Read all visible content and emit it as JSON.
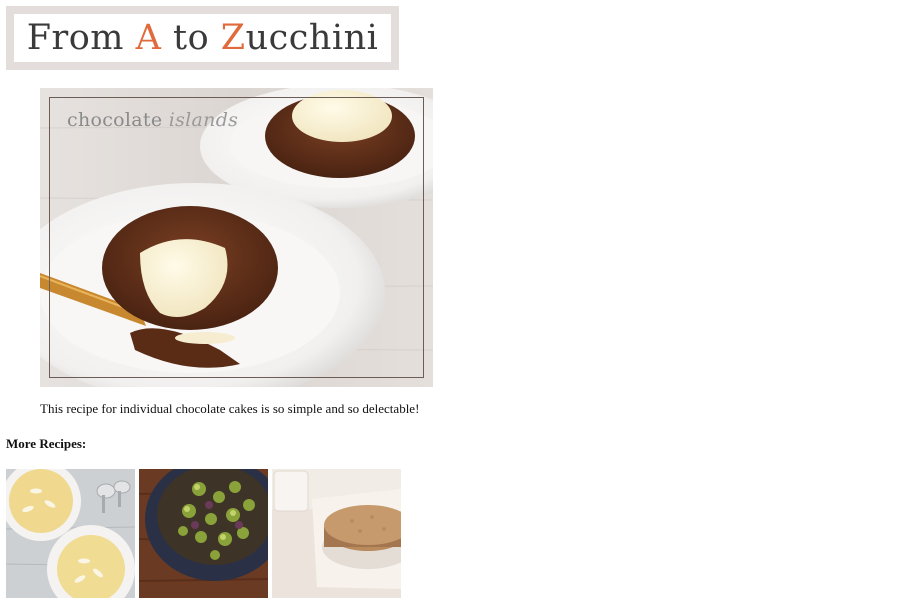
{
  "site": {
    "logo_parts": [
      "From ",
      "A",
      " to ",
      "Z",
      "ucchini"
    ],
    "accent_color": "#e06a3b"
  },
  "hero": {
    "title_word": "chocolate",
    "title_italic": "islands"
  },
  "description": "This recipe for individual chocolate cakes is so simple and so delectable!",
  "more_recipes": {
    "heading": "More Recipes:"
  }
}
